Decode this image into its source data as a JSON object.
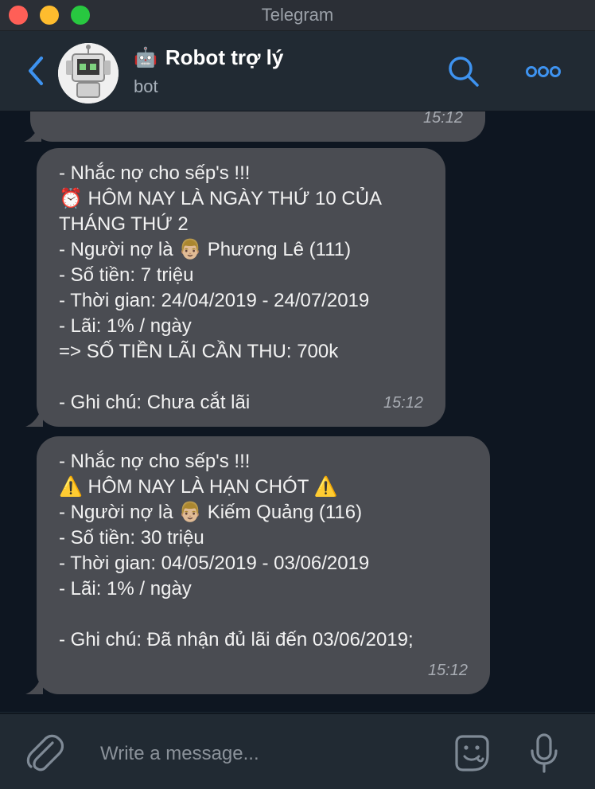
{
  "window": {
    "title": "Telegram"
  },
  "header": {
    "chat_name": "Robot trợ lý",
    "bot_emoji": "🤖",
    "subtitle": "bot"
  },
  "messages": [
    {
      "text": "",
      "time": "15:12"
    },
    {
      "text": "- Nhắc nợ cho sếp's !!!\n⏰ HÔM NAY LÀ NGÀY THỨ 10 CỦA\nTHÁNG THỨ 2\n- Người nợ là 👨🏼 Phương Lê (111)\n- Số tiền: 7 triệu\n- Thời gian: 24/04/2019 - 24/07/2019\n- Lãi: 1% / ngày\n=> SỐ TIỀN LÃI CẦN THU: 700k\n\n- Ghi chú: Chưa cắt lãi",
      "time": "15:12"
    },
    {
      "text": "- Nhắc nợ cho sếp's !!!\n⚠️ HÔM NAY LÀ HẠN CHÓT ⚠️\n- Người nợ là 👨🏼 Kiếm Quảng (116)\n- Số tiền: 30 triệu\n- Thời gian: 04/05/2019 - 03/06/2019\n- Lãi: 1% / ngày\n\n- Ghi chú: Đã nhận đủ lãi đến 03/06/2019;",
      "time": "15:12"
    }
  ],
  "composer": {
    "placeholder": "Write a message..."
  },
  "colors": {
    "accent": "#3e93f0",
    "bubble": "#4a4c52",
    "chat_bg": "#0e1621"
  },
  "icons": [
    "back-arrow-icon",
    "search-icon",
    "more-icon",
    "attach-icon",
    "sticker-icon",
    "mic-icon"
  ]
}
